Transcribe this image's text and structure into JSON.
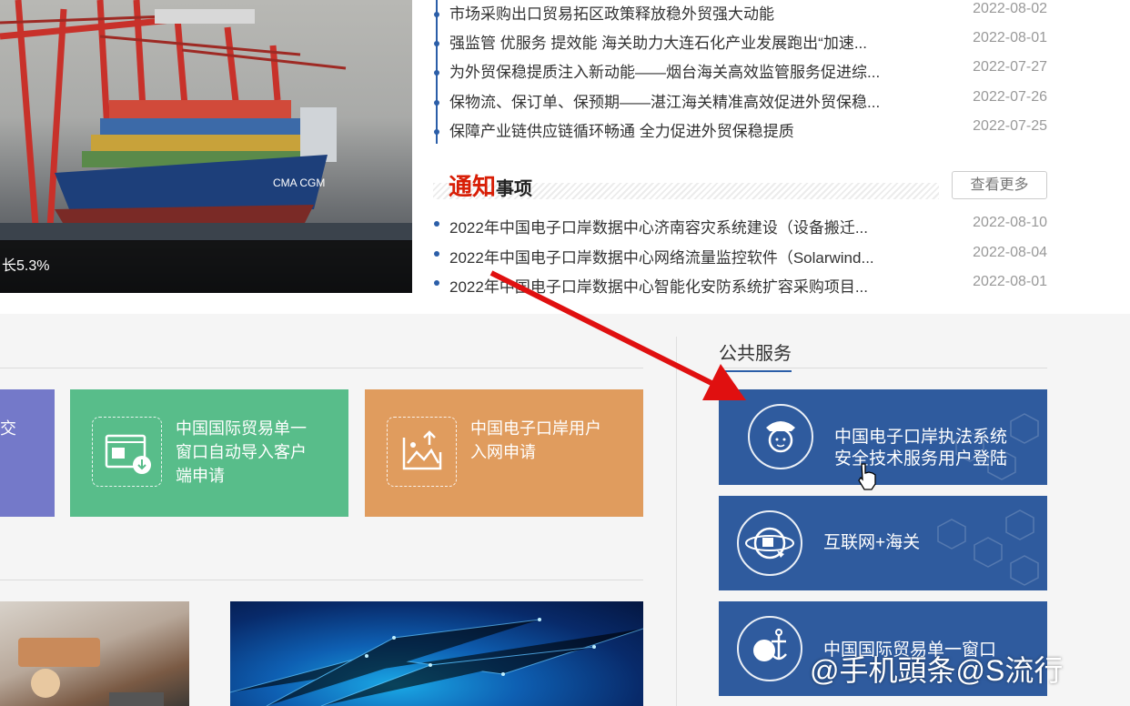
{
  "hero": {
    "caption": "长5.3%"
  },
  "news": [
    {
      "title": "市场采购出口贸易拓区政策释放稳外贸强大动能",
      "date": "2022-08-02"
    },
    {
      "title": "强监管 优服务 提效能 海关助力大连石化产业发展跑出“加速...",
      "date": "2022-08-01"
    },
    {
      "title": "为外贸保稳提质注入新动能——烟台海关高效监管服务促进综...",
      "date": "2022-07-27"
    },
    {
      "title": "保物流、保订单、保预期——湛江海关精准高效促进外贸保稳...",
      "date": "2022-07-26"
    },
    {
      "title": "保障产业链供应链循环畅通 全力促进外贸保稳提质",
      "date": "2022-07-25"
    }
  ],
  "notice": {
    "title_red": "通知",
    "title_black": "事项",
    "more": "查看更多",
    "items": [
      {
        "title": "2022年中国电子口岸数据中心济南容灾系统建设（设备搬迁...",
        "date": "2022-08-10"
      },
      {
        "title": "2022年中国电子口岸数据中心网络流量监控软件（Solarwind...",
        "date": "2022-08-04"
      },
      {
        "title": "2022年中国电子口岸数据中心智能化安防系统扩容采购项目...",
        "date": "2022-08-01"
      }
    ]
  },
  "tiles": {
    "purple": "交",
    "green": "中国国际贸易单一窗口自动导入客户端申请",
    "orange": "中国电子口岸用户入网申请"
  },
  "public_service": {
    "title": "公共服务",
    "items": [
      {
        "label_line1": "中国电子口岸执法系统",
        "label_line2": "安全技术服务用户登陆",
        "icon": "customs-officer-icon"
      },
      {
        "label_line1": "互联网+海关",
        "label_line2": "",
        "icon": "globe-network-icon"
      },
      {
        "label_line1": "中国国际贸易单一窗口",
        "label_line2": "",
        "icon": "globe-anchor-icon"
      }
    ]
  },
  "watermark": "@手机頭条@S流行",
  "colors": {
    "primary_blue": "#2f5b9e",
    "accent_red": "#d81e06",
    "tile_purple": "#7479c9",
    "tile_green": "#58bd8a",
    "tile_orange": "#e09c5e",
    "arrow_red": "#e01010"
  }
}
